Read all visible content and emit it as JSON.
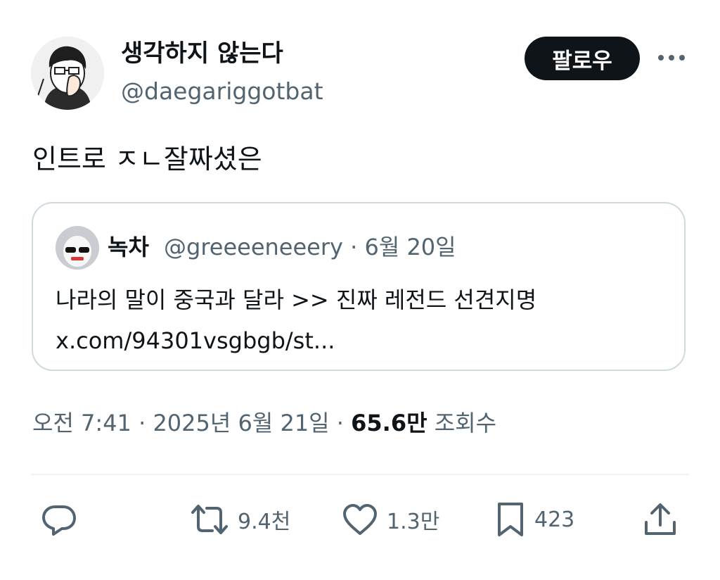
{
  "author": {
    "display_name": "생각하지 않는다",
    "handle": "@daegariggotbat"
  },
  "follow_button": "팔로우",
  "more_icon": "more-horizontal-icon",
  "tweet_text": "인트로 ㅈㄴ잘짜셨은",
  "quote": {
    "name": "녹차",
    "handle": "@greeeeneeery",
    "date": "· 6월 20일",
    "text_line1": "나라의 말이 중국과 달라 >> 진짜 레전드 선견지명",
    "text_line2": "x.com/94301vsgbgb/st..."
  },
  "meta": {
    "time": "오전 7:41",
    "sep1": "·",
    "date": "2025년 6월 21일",
    "sep2": "·",
    "views_count": "65.6만",
    "views_label": "조회수"
  },
  "actions": {
    "reply": {
      "icon": "reply-icon",
      "count": ""
    },
    "retweet": {
      "icon": "retweet-icon",
      "count": "9.4천"
    },
    "like": {
      "icon": "heart-icon",
      "count": "1.3만"
    },
    "bookmark": {
      "icon": "bookmark-icon",
      "count": "423"
    },
    "share": {
      "icon": "share-icon",
      "count": ""
    }
  },
  "colors": {
    "text": "#0f1419",
    "secondary": "#536471",
    "border": "#cfd9de",
    "button_bg": "#0f1419"
  }
}
